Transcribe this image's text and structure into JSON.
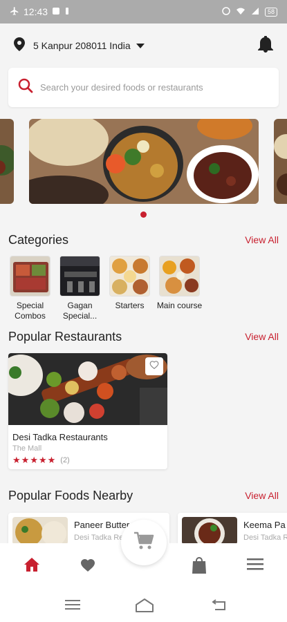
{
  "status_bar": {
    "time": "12:43",
    "battery": "58"
  },
  "header": {
    "location": "5 Kanpur 208011 India"
  },
  "search": {
    "placeholder": "Search your desired foods or restaurants"
  },
  "carousel": {
    "active_index": 0,
    "slides": 3
  },
  "categories": {
    "title": "Categories",
    "view_all": "View All",
    "items": [
      {
        "name": "Special Combos"
      },
      {
        "name": "Gagan Special..."
      },
      {
        "name": "Starters"
      },
      {
        "name": "Main course"
      }
    ]
  },
  "popular_restaurants": {
    "title": "Popular Restaurants",
    "view_all": "View All",
    "items": [
      {
        "name": "Desi Tadka Restaurants",
        "location": "The Mall",
        "rating": 5,
        "reviews": "(2)"
      }
    ]
  },
  "popular_foods": {
    "title": "Popular Foods Nearby",
    "view_all": "View All",
    "items": [
      {
        "name": "Paneer Butter",
        "restaurant": "Desi Tadka Re"
      },
      {
        "name": "Keema Pa",
        "restaurant": "Desi Tadka Re"
      }
    ]
  },
  "colors": {
    "accent": "#c8202f",
    "status_bar": "#ababab"
  }
}
